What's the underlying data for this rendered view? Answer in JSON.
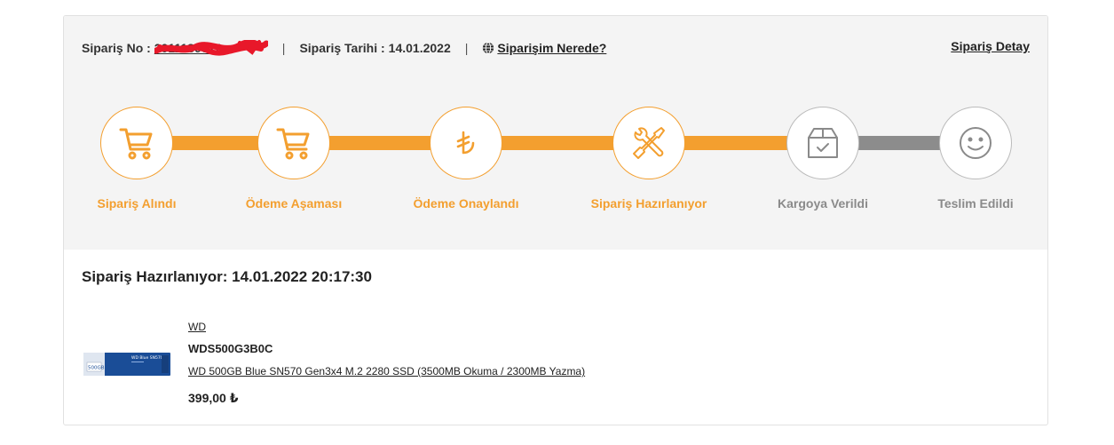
{
  "header": {
    "order_no_label": "Sipariş No :",
    "order_no_value": "2011130012",
    "separator": "|",
    "order_date_label": "Sipariş Tarihi :",
    "order_date_value": "14.01.2022",
    "where_link": "Siparişim Nerede?",
    "detail_link": "Sipariş Detay"
  },
  "steps": [
    {
      "label": "Sipariş Alındı",
      "icon": "cart-icon",
      "state": "done"
    },
    {
      "label": "Ödeme Aşaması",
      "icon": "cart-icon",
      "state": "done"
    },
    {
      "label": "Ödeme Onaylandı",
      "icon": "lira-icon",
      "state": "done"
    },
    {
      "label": "Sipariş Hazırlanıyor",
      "icon": "tools-icon",
      "state": "done"
    },
    {
      "label": "Kargoya Verildi",
      "icon": "box-icon",
      "state": "pending"
    },
    {
      "label": "Teslim Edildi",
      "icon": "smile-icon",
      "state": "pending"
    }
  ],
  "status": {
    "title": "Sipariş Hazırlanıyor: 14.01.2022 20:17:30"
  },
  "product": {
    "brand": "WD",
    "code": "WDS500G3B0C",
    "name": "WD 500GB Blue SN570 Gen3x4 M.2 2280 SSD (3500MB Okuma / 2300MB Yazma)",
    "price": "399,00 ₺",
    "image_text": "WD Blue SN570",
    "image_capacity": "500GB"
  },
  "colors": {
    "accent": "#f39f2f",
    "pending": "#8a8a8a",
    "panel": "#f4f4f4"
  }
}
